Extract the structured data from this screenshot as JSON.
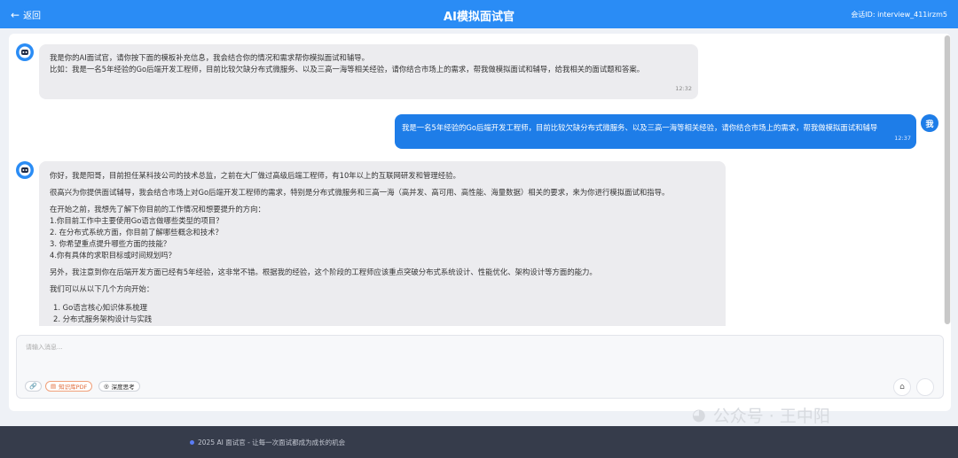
{
  "header": {
    "back_label": "返回",
    "title": "AI模拟面试官",
    "session": "会话ID: interview_411irzm5"
  },
  "messages": {
    "m1": {
      "line1": "我是你的AI面试官，请你按下面的模板补充信息，我会结合你的情况和需求帮你模拟面试和辅导。",
      "line2": "比如：我是一名5年经验的Go后端开发工程师，目前比较欠缺分布式微服务、以及三高一海等相关经验，请你结合市场上的需求，帮我做模拟面试和辅导，给我相关的面试题和答案。",
      "time": "12:32"
    },
    "m2": {
      "text": "我是一名5年经验的Go后端开发工程师，目前比较欠缺分布式微服务、以及三高一海等相关经验，请你结合市场上的需求，帮我做模拟面试和辅导",
      "time": "12:37",
      "avatar": "我"
    },
    "m3": {
      "p1": "你好，我是阳哥，目前担任某科技公司的技术总监，之前在大厂做过高级后端工程师，有10年以上的互联网研发和管理经验。",
      "p2": "很高兴为你提供面试辅导，我会结合市场上对Go后端开发工程师的需求，特别是分布式微服务和三高一海（高并发、高可用、高性能、海量数据）相关的要求，来为你进行模拟面试和指导。",
      "p3": "在开始之前，我想先了解下你目前的工作情况和想要提升的方向：",
      "q1": "1.你目前工作中主要使用Go语言做哪些类型的项目？",
      "q2": "2. 在分布式系统方面，你目前了解哪些概念和技术？",
      "q3": "3. 你希望重点提升哪些方面的技能？",
      "q4": "4.你有具体的求职目标或时间规划吗？",
      "p4": "另外，我注意到你在后端开发方面已经有5年经验，这非常不错。根据我的经验，这个阶段的工程师应该重点突破分布式系统设计、性能优化、架构设计等方面的能力。",
      "p5": "我们可以从以下几个方向开始：",
      "d1": "1.  Go语言核心知识体系梳理",
      "d2": "2.  分布式服务架构设计与实践"
    }
  },
  "input": {
    "placeholder": "请输入消息...",
    "pdf_label": "知识库PDF",
    "think_label": "深度思考"
  },
  "footer": {
    "text": "2025 AI 面试官 - 让每一次面试都成为成长的机会"
  },
  "watermark": {
    "text": "公众号 · 王中阳"
  },
  "colors": {
    "primary": "#2a8cf5",
    "user_bubble": "#1e7de8",
    "footer_bg": "#363c4b"
  }
}
